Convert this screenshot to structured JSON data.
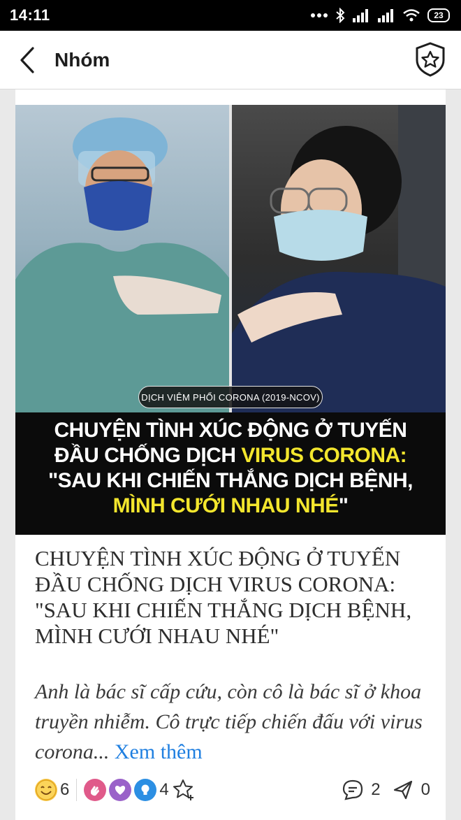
{
  "status_bar": {
    "time": "14:11",
    "battery": "23"
  },
  "app_bar": {
    "title": "Nhóm"
  },
  "post": {
    "image": {
      "tag": "DỊCH VIÊM PHỔI CORONA (2019-NCOV)",
      "headline_line1": "CHUYỆN TÌNH XÚC ĐỘNG Ở TUYẾN",
      "headline_line2_white": "ĐẦU CHỐNG DỊCH ",
      "headline_line2_yellow": "VIRUS CORONA:",
      "headline_line3": "\"SAU KHI CHIẾN THẮNG DỊCH BỆNH,",
      "headline_line4_yellow": "MÌNH CƯỚI NHAU NHÉ",
      "headline_line4_white": "\""
    },
    "title": "CHUYỆN TÌNH XÚC ĐỘNG Ở TUYẾN ĐẦU CHỐNG DỊCH VIRUS CORONA: \"SAU KHI CHIẾN THẮNG DỊCH BỆNH, MÌNH CƯỚI NHAU NHÉ\"",
    "excerpt": "Anh là bác sĩ cấp cứu, còn cô là bác sĩ ở khoa truyền nhiễm. Cô trực tiếp chiến đấu với virus corona... ",
    "see_more": "Xem thêm",
    "reactions": {
      "smile_count": "6",
      "group_count": "4",
      "comment_count": "2",
      "share_count": "0"
    }
  },
  "colors": {
    "accent_yellow": "#f3e62d",
    "link_blue": "#1f7fe0"
  }
}
